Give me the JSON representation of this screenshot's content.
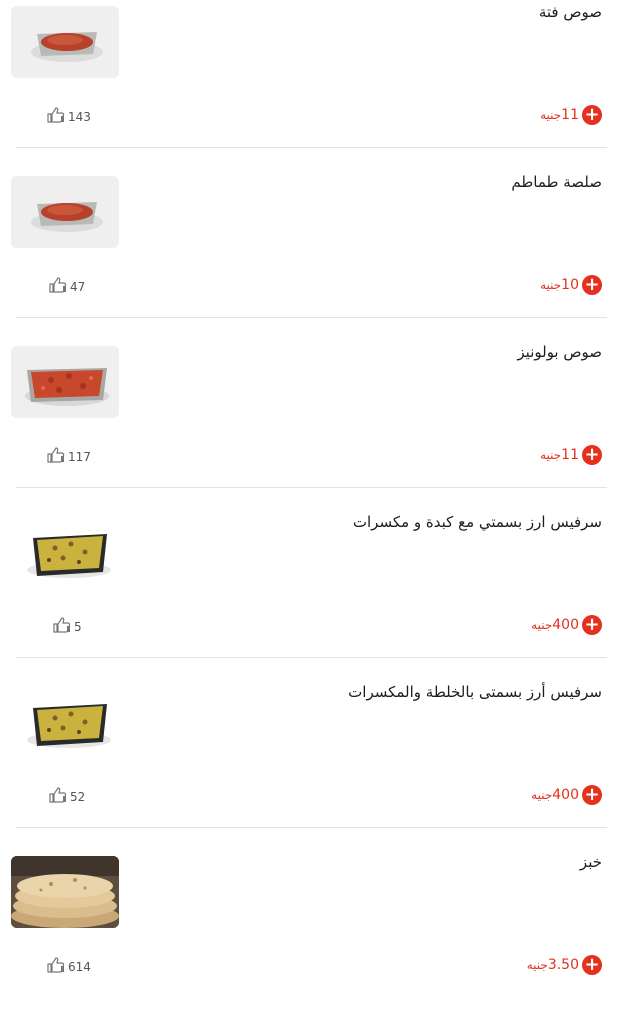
{
  "currency": "جنيه",
  "accent_color": "#e4301c",
  "items": [
    {
      "name": "صوص فتة",
      "price": "11",
      "likes": "143",
      "image": "red-sauce-tray"
    },
    {
      "name": "صلصة طماطم",
      "price": "10",
      "likes": "47",
      "image": "red-sauce-tray"
    },
    {
      "name": "صوص بولونيز",
      "price": "11",
      "likes": "117",
      "image": "bolognese-tray"
    },
    {
      "name": "سرفيس ارز بسمتي مع كبدة و مكسرات",
      "price": "400",
      "likes": "5",
      "image": "rice-tray"
    },
    {
      "name": "سرفيس أرز بسمتى بالخلطة والمكسرات",
      "price": "400",
      "likes": "52",
      "image": "rice-tray"
    },
    {
      "name": "خبز",
      "price": "3.50",
      "likes": "614",
      "image": "bread-stack"
    }
  ]
}
